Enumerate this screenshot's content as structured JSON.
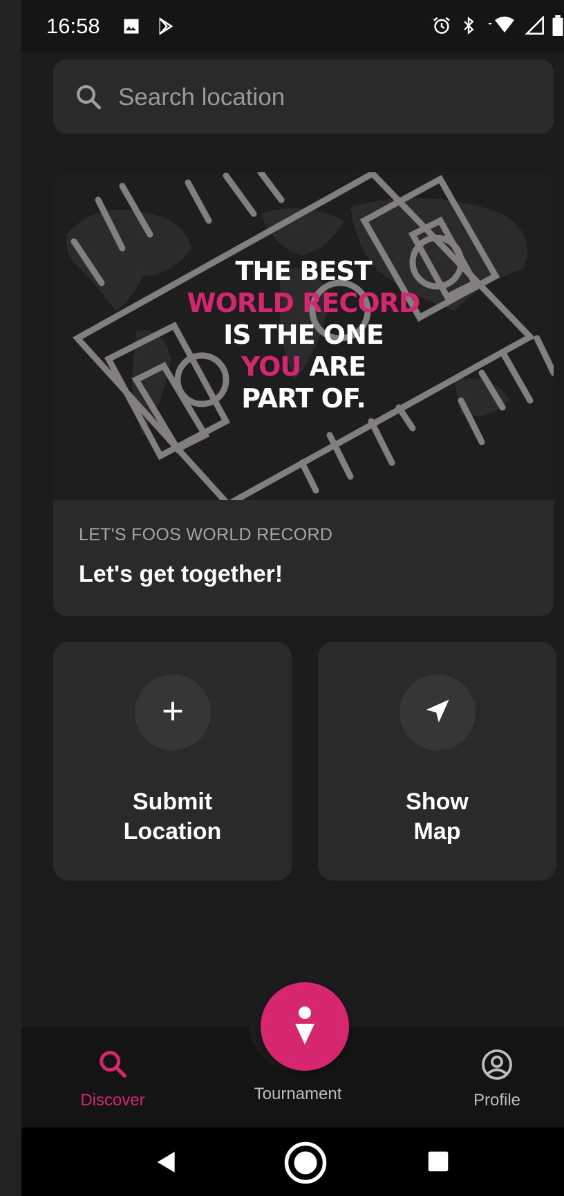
{
  "status_bar": {
    "time": "16:58",
    "icons": [
      "image-icon",
      "play-store-icon",
      "alarm-icon",
      "bluetooth-icon",
      "wifi-icon",
      "signal-icon",
      "battery-icon"
    ]
  },
  "search": {
    "placeholder": "Search location"
  },
  "banner": {
    "slogan": {
      "line1": "THE BEST",
      "line2": "WORLD RECORD",
      "line3": "IS THE ONE",
      "line4_highlight": "YOU",
      "line4_rest": " ARE",
      "line5": "PART OF."
    },
    "eyebrow": "LET'S FOOS WORLD RECORD",
    "title": "Let's get together!"
  },
  "actions": {
    "submit": {
      "line1": "Submit",
      "line2": "Location",
      "icon": "plus-icon"
    },
    "map": {
      "line1": "Show",
      "line2": "Map",
      "icon": "navigation-arrow-icon"
    }
  },
  "bottom_nav": {
    "discover": "Discover",
    "tournament": "Tournament",
    "profile": "Profile",
    "active": "discover"
  },
  "colors": {
    "accent": "#d6266f",
    "background": "#1c1c1c",
    "card": "#2a2a2a"
  }
}
